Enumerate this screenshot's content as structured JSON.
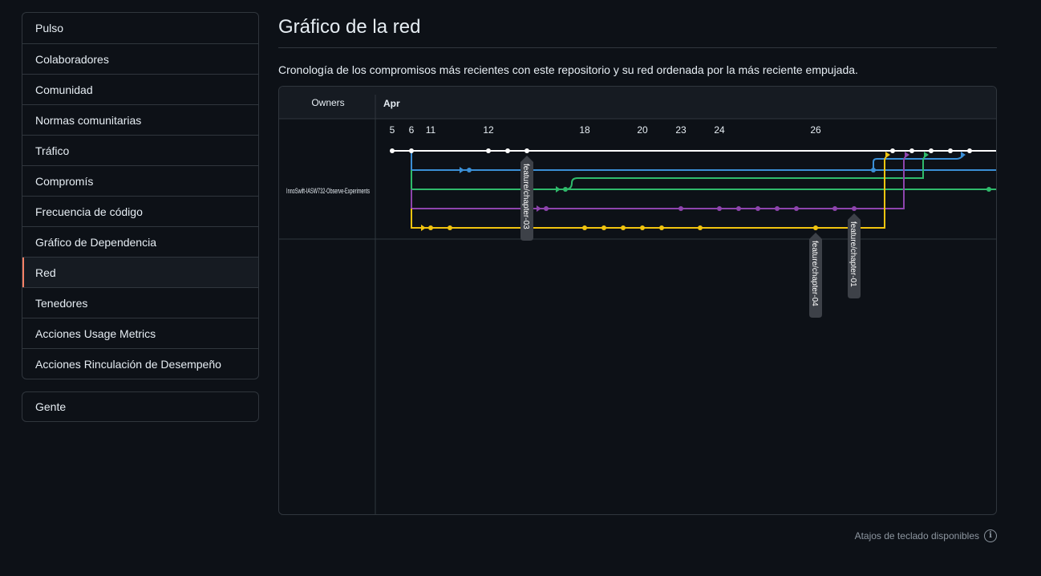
{
  "sidebar": {
    "items": [
      {
        "label": "Pulso"
      },
      {
        "label": "Colaboradores"
      },
      {
        "label": "Comunidad"
      },
      {
        "label": "Normas comunitarias"
      },
      {
        "label": "Tráfico"
      },
      {
        "label": "Compromís"
      },
      {
        "label": "Frecuencia de código"
      },
      {
        "label": "Gráfico de Dependencia"
      },
      {
        "label": "Red",
        "selected": true
      },
      {
        "label": "Tenedores"
      },
      {
        "label": "Acciones Usage Metrics"
      },
      {
        "label": "Acciones Rinculación de Desempeño"
      }
    ],
    "secondary": [
      {
        "label": "Gente"
      }
    ]
  },
  "header": {
    "title": "Gráfico de la red",
    "description": "Cronología de los compromisos más recientes con este repositorio y su red ordenada por la más reciente empujada."
  },
  "network": {
    "owners_label": "Owners",
    "month_label": "Apr",
    "owner_name": "InnoSwift-IASW732-Observe-Experiments",
    "day_labels": [
      "5",
      "6",
      "11",
      "12",
      "18",
      "20",
      "23",
      "24",
      "26"
    ],
    "branch_labels": [
      "feature/chapter-03",
      "feature/chapter-04",
      "feature/chapter-01"
    ],
    "colors": {
      "master": "#ffffff",
      "blue": "#3b8fd6",
      "green": "#2fba6b",
      "purple": "#8e44ad",
      "yellow": "#f1c40f",
      "label_bg": "#3d4148"
    }
  },
  "footer": {
    "shortcuts_text": "Atajos de teclado disponibles",
    "info_icon": "info-icon"
  }
}
